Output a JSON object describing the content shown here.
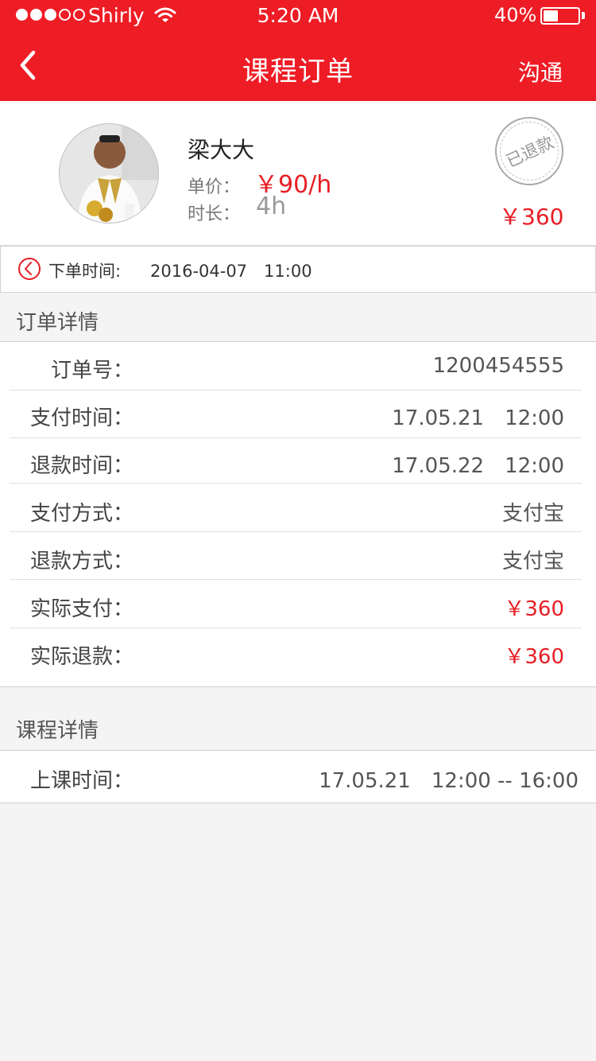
{
  "colors": {
    "accent": "#ee1c25",
    "price": "#e81e25"
  },
  "status_bar": {
    "carrier": "Shirly",
    "time": "5:20 AM",
    "battery": "40%",
    "signal_icon": "signal-dots-icon",
    "wifi_icon": "wifi-icon",
    "battery_icon": "battery-icon",
    "battery_level": 0.4
  },
  "nav": {
    "back_icon": "chevron-left-icon",
    "title": "课程订单",
    "action": "沟通"
  },
  "profile": {
    "name": "梁大大",
    "price_label": "单价：",
    "price": "￥90/h",
    "duration_label": "时长：",
    "duration": "4h",
    "stamp": "已退款",
    "total": "￥360"
  },
  "order_time": {
    "icon": "clock-icon",
    "label": "下单时间:",
    "value": "2016-04-07　11:00"
  },
  "order_details": {
    "title": "订单详情",
    "rows": [
      {
        "label": "　订单号：",
        "value": "1200454555"
      },
      {
        "label": "支付时间：",
        "value": "17.05.21　12:00"
      },
      {
        "label": "退款时间：",
        "value": "17.05.22　12:00"
      },
      {
        "label": "支付方式：",
        "value": "支付宝"
      },
      {
        "label": "退款方式：",
        "value": "支付宝"
      },
      {
        "label": "实际支付：",
        "value": "￥360"
      },
      {
        "label": "实际退款：",
        "value": "￥360"
      }
    ]
  },
  "course_details": {
    "title": "课程详情",
    "rows": [
      {
        "label": "上课时间：",
        "value": "17.05.21　12:00 -- 16:00"
      }
    ]
  }
}
